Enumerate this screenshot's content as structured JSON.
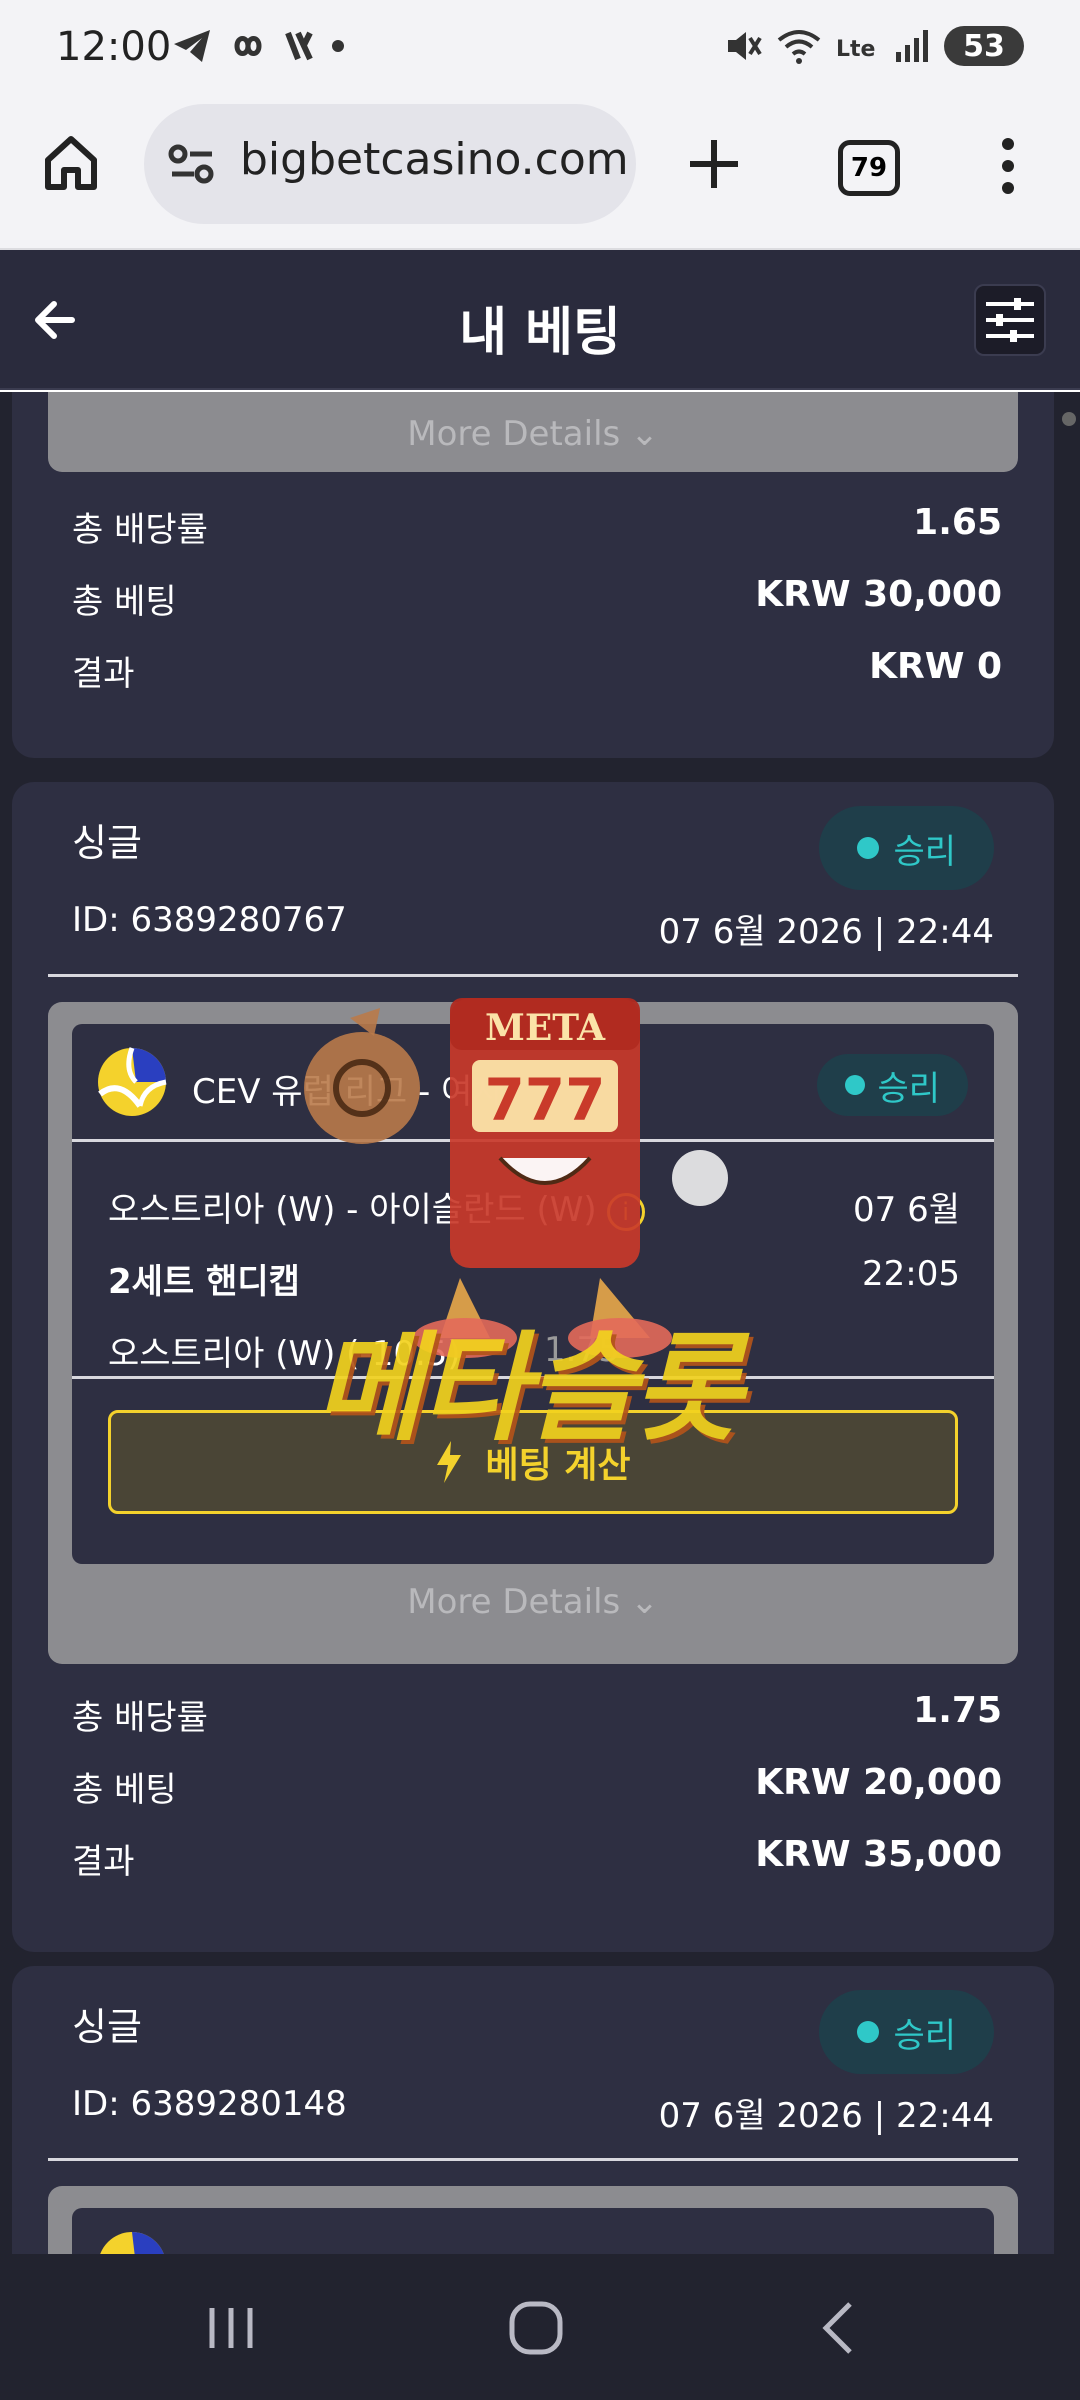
{
  "status_bar": {
    "time": "12:00",
    "battery": "53",
    "icons": [
      "telegram-icon",
      "infinity-icon",
      "app-icon",
      "dot-icon",
      "mute-icon",
      "wifi-icon",
      "volte-icon",
      "signal-icon",
      "battery-icon"
    ]
  },
  "browser": {
    "url": "bigbetcasino.com",
    "tab_count": "79"
  },
  "header": {
    "title": "내 베팅"
  },
  "more_details_label": "More Details",
  "cards": [
    {
      "summary": [
        {
          "label": "총 배당률",
          "value": "1.65"
        },
        {
          "label": "총 베팅",
          "value": "KRW 30,000"
        },
        {
          "label": "결과",
          "value": "KRW 0"
        }
      ]
    },
    {
      "type": "싱글",
      "status": "승리",
      "id": "ID: 6389280767",
      "date": "07 6월 2026 | 22:44",
      "event": {
        "league": "CEV 유럽 리그 - 여자",
        "status": "승리",
        "teams": "오스트리아 (W) - 아이슬란드 (W)",
        "date": "07 6월",
        "market": "2세트 핸디캡",
        "time": "22:05",
        "selection": "오스트리아 (W) (-10.5)",
        "odds": "1.75",
        "calc_label": "베팅 계산"
      },
      "summary": [
        {
          "label": "총 배당률",
          "value": "1.75"
        },
        {
          "label": "총 베팅",
          "value": "KRW 20,000"
        },
        {
          "label": "결과",
          "value": "KRW 35,000"
        }
      ]
    },
    {
      "type": "싱글",
      "status": "승리",
      "id": "ID: 6389280148",
      "date": "07 6월 2026 | 22:44"
    }
  ],
  "watermark": {
    "sign": "META",
    "reels": "777",
    "brand": "메타슬롯"
  },
  "colors": {
    "background": "#22232f",
    "card": "#2e2f42",
    "accent_win": "#2fc8c8",
    "accent_button": "#f4d22c"
  }
}
